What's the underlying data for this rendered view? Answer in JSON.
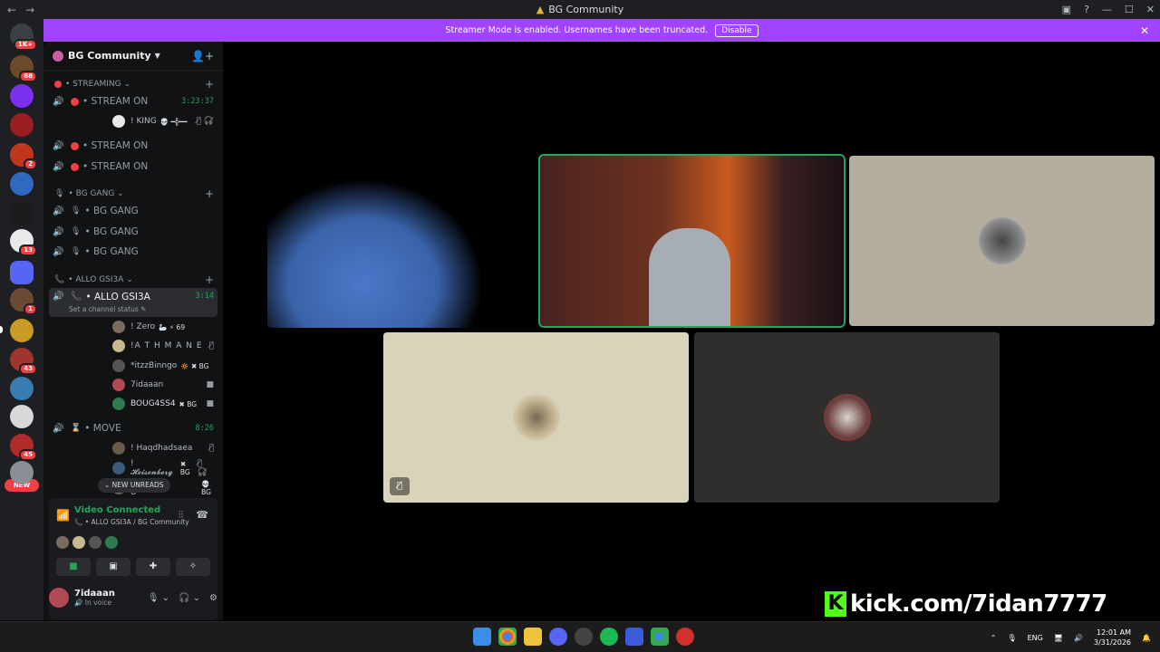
{
  "window": {
    "title": "BG Community",
    "nav_back": "←",
    "nav_fwd": "→"
  },
  "banner": {
    "text": "Streamer Mode is enabled. Usernames have been truncated.",
    "button": "Disable",
    "close": "✕"
  },
  "rail": {
    "servers": [
      {
        "color": "#3b3f45",
        "badge": "1K+"
      },
      {
        "color": "#6b4a2a",
        "badge": "68"
      },
      {
        "color": "#7b2ff0",
        "badge": ""
      },
      {
        "color": "#9a1f24",
        "badge": ""
      },
      {
        "color": "#c1361e",
        "badge": "2"
      },
      {
        "color": "#2f6ac0",
        "badge": ""
      },
      {
        "color": "#1b1b1b",
        "badge": ""
      },
      {
        "color": "#e9e9e9",
        "badge": "13"
      },
      {
        "color": "#5865f2",
        "badge": ""
      },
      {
        "color": "#6a4a33",
        "badge": "1"
      },
      {
        "color": "#c99a24",
        "badge": ""
      },
      {
        "color": "#a0352d",
        "badge": "43"
      },
      {
        "color": "#3a7bb0",
        "badge": ""
      },
      {
        "color": "#d8d8d8",
        "badge": ""
      },
      {
        "color": "#b02a2a",
        "badge": "45"
      },
      {
        "color": "#8a8f96",
        "badge": ""
      }
    ],
    "new_label": "NEW"
  },
  "sidebar": {
    "server_name": "BG Community",
    "categories": {
      "streaming": "STREAMING",
      "bg_gang": "BG GANG",
      "allo": "ALLO GSI3A"
    },
    "channels": {
      "stream1": {
        "name": "STREAM ON",
        "timer": "3:23:37"
      },
      "stream2": {
        "name": "STREAM ON"
      },
      "stream3": {
        "name": "STREAM ON"
      },
      "bg1": {
        "name": "BG GANG"
      },
      "bg2": {
        "name": "BG GANG"
      },
      "bg3": {
        "name": "BG GANG"
      },
      "allo": {
        "name": "ALLO GSI3A",
        "timer": "3:14",
        "status": "Set a channel status"
      },
      "move": {
        "name": "MOVE",
        "timer": "8:26"
      }
    },
    "members": {
      "king": {
        "name": "! KING",
        "tag": "💀 ━╬━━"
      },
      "zero": {
        "name": "! Zero",
        "tag": "🦢 ⚡ 69"
      },
      "athmane": {
        "name": "!A T H M A N E",
        "tag": ""
      },
      "itzz": {
        "name": "*itzzBinngo",
        "tag": "🔅 ✖ BG"
      },
      "tidaaan": {
        "name": "7idaaan",
        "tag": ""
      },
      "boug": {
        "name": "BOUG4SS4",
        "tag": "✖ BG"
      },
      "haqd": {
        "name": "! Haqdhadsaea",
        "tag": ""
      },
      "heis": {
        "name": "! 𝓗𝓮𝓲𝓼𝓮𝓷𝓫𝓮𝓻𝓰",
        "tag": "✖ BG"
      },
      "u": {
        "name": "! U",
        "tag": "💀 BG"
      }
    },
    "new_unreads": "NEW UNREADS"
  },
  "voice": {
    "connected": "Video Connected",
    "location": "ALLO GSI3A / BG Community"
  },
  "user": {
    "name": "7idaaan",
    "status": "In voice"
  },
  "overlay": {
    "kick": "kick.com/7idan7777",
    "k": "K"
  },
  "taskbar": {
    "lang": "ENG",
    "time": "12:01 AM",
    "date": "3/31/2026"
  }
}
